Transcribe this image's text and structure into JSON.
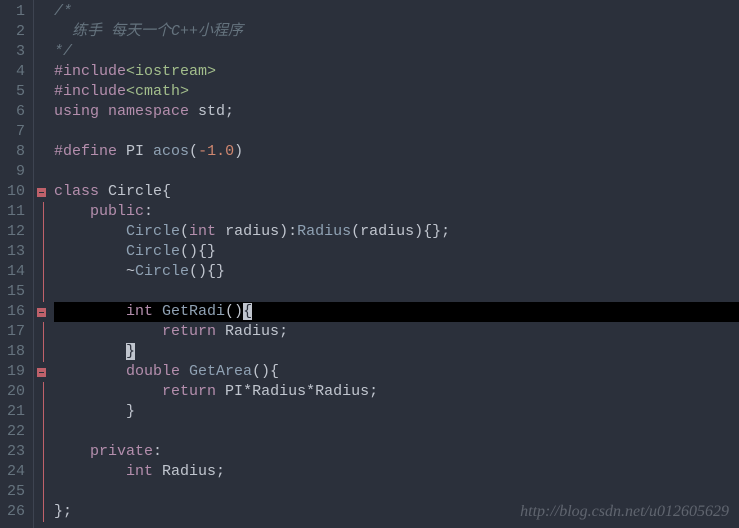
{
  "watermark": "http://blog.csdn.net/u012605629",
  "lines": {
    "l1": {
      "num": "1",
      "tokens": [
        [
          "/*",
          "comment"
        ]
      ]
    },
    "l2": {
      "num": "2",
      "tokens": [
        [
          "  练手 每天一个C++小程序",
          "comment"
        ]
      ]
    },
    "l3": {
      "num": "3",
      "tokens": [
        [
          "*/",
          "comment"
        ]
      ]
    },
    "l4": {
      "num": "4",
      "tokens": [
        [
          "#include",
          "preproc"
        ],
        [
          "<iostream>",
          "include"
        ]
      ]
    },
    "l5": {
      "num": "5",
      "tokens": [
        [
          "#include",
          "preproc"
        ],
        [
          "<cmath>",
          "include"
        ]
      ]
    },
    "l6": {
      "num": "6",
      "tokens": [
        [
          "using ",
          "keyword"
        ],
        [
          "namespace ",
          "keyword"
        ],
        [
          "std",
          "ident"
        ],
        [
          ";",
          "punct"
        ]
      ]
    },
    "l7": {
      "num": "7",
      "tokens": []
    },
    "l8": {
      "num": "8",
      "tokens": [
        [
          "#define ",
          "preproc"
        ],
        [
          "PI ",
          "ident"
        ],
        [
          "acos",
          "func"
        ],
        [
          "(",
          "punct"
        ],
        [
          "-1.0",
          "num"
        ],
        [
          ")",
          "punct"
        ]
      ]
    },
    "l9": {
      "num": "9",
      "tokens": []
    },
    "l10": {
      "num": "10",
      "tokens": [
        [
          "class ",
          "keyword"
        ],
        [
          "Circle",
          "ident"
        ],
        [
          "{",
          "punct"
        ]
      ]
    },
    "l11": {
      "num": "11",
      "tokens": [
        [
          "    ",
          "ident"
        ],
        [
          "public",
          "keyword"
        ],
        [
          ":",
          "punct"
        ]
      ]
    },
    "l12": {
      "num": "12",
      "tokens": [
        [
          "        ",
          "ident"
        ],
        [
          "Circle",
          "func"
        ],
        [
          "(",
          "punct"
        ],
        [
          "int ",
          "type"
        ],
        [
          "radius",
          "ident"
        ],
        [
          "):",
          "punct"
        ],
        [
          "Radius",
          "func"
        ],
        [
          "(",
          "punct"
        ],
        [
          "radius",
          "ident"
        ],
        [
          "){};",
          "punct"
        ]
      ]
    },
    "l13": {
      "num": "13",
      "tokens": [
        [
          "        ",
          "ident"
        ],
        [
          "Circle",
          "func"
        ],
        [
          "(){}",
          "punct"
        ]
      ]
    },
    "l14": {
      "num": "14",
      "tokens": [
        [
          "        ~",
          "ident"
        ],
        [
          "Circle",
          "func"
        ],
        [
          "(){}",
          "punct"
        ]
      ]
    },
    "l15": {
      "num": "15",
      "tokens": []
    },
    "l16": {
      "num": "16",
      "tokens": [
        [
          "        ",
          "ident"
        ],
        [
          "int ",
          "type"
        ],
        [
          "GetRadi",
          "func"
        ],
        [
          "()",
          "punct"
        ],
        [
          "{",
          "brace-hl"
        ]
      ]
    },
    "l17": {
      "num": "17",
      "tokens": [
        [
          "            ",
          "ident"
        ],
        [
          "return ",
          "keyword"
        ],
        [
          "Radius",
          "ident"
        ],
        [
          ";",
          "punct"
        ]
      ]
    },
    "l18": {
      "num": "18",
      "tokens": [
        [
          "        ",
          "ident"
        ],
        [
          "}",
          "brace-hl"
        ]
      ]
    },
    "l19": {
      "num": "19",
      "tokens": [
        [
          "        ",
          "ident"
        ],
        [
          "double ",
          "type"
        ],
        [
          "GetArea",
          "func"
        ],
        [
          "(){",
          "punct"
        ]
      ]
    },
    "l20": {
      "num": "20",
      "tokens": [
        [
          "            ",
          "ident"
        ],
        [
          "return ",
          "keyword"
        ],
        [
          "PI",
          "ident"
        ],
        [
          "*",
          "punct"
        ],
        [
          "Radius",
          "ident"
        ],
        [
          "*",
          "punct"
        ],
        [
          "Radius",
          "ident"
        ],
        [
          ";",
          "punct"
        ]
      ]
    },
    "l21": {
      "num": "21",
      "tokens": [
        [
          "        }",
          "punct"
        ]
      ]
    },
    "l22": {
      "num": "22",
      "tokens": []
    },
    "l23": {
      "num": "23",
      "tokens": [
        [
          "    ",
          "ident"
        ],
        [
          "private",
          "keyword"
        ],
        [
          ":",
          "punct"
        ]
      ]
    },
    "l24": {
      "num": "24",
      "tokens": [
        [
          "        ",
          "ident"
        ],
        [
          "int ",
          "type"
        ],
        [
          "Radius",
          "ident"
        ],
        [
          ";",
          "punct"
        ]
      ]
    },
    "l25": {
      "num": "25",
      "tokens": []
    },
    "l26": {
      "num": "26",
      "tokens": [
        [
          "};",
          "punct"
        ]
      ]
    }
  },
  "fold": {
    "f10": "minus",
    "f11": "line",
    "f12": "line",
    "f13": "line",
    "f14": "line",
    "f15": "line",
    "f16": "minus",
    "f17": "line",
    "f18": "line",
    "f19": "minus",
    "f20": "line",
    "f21": "line",
    "f22": "line",
    "f23": "line",
    "f24": "line",
    "f25": "line",
    "f26": "line"
  },
  "highlight_line": 16
}
